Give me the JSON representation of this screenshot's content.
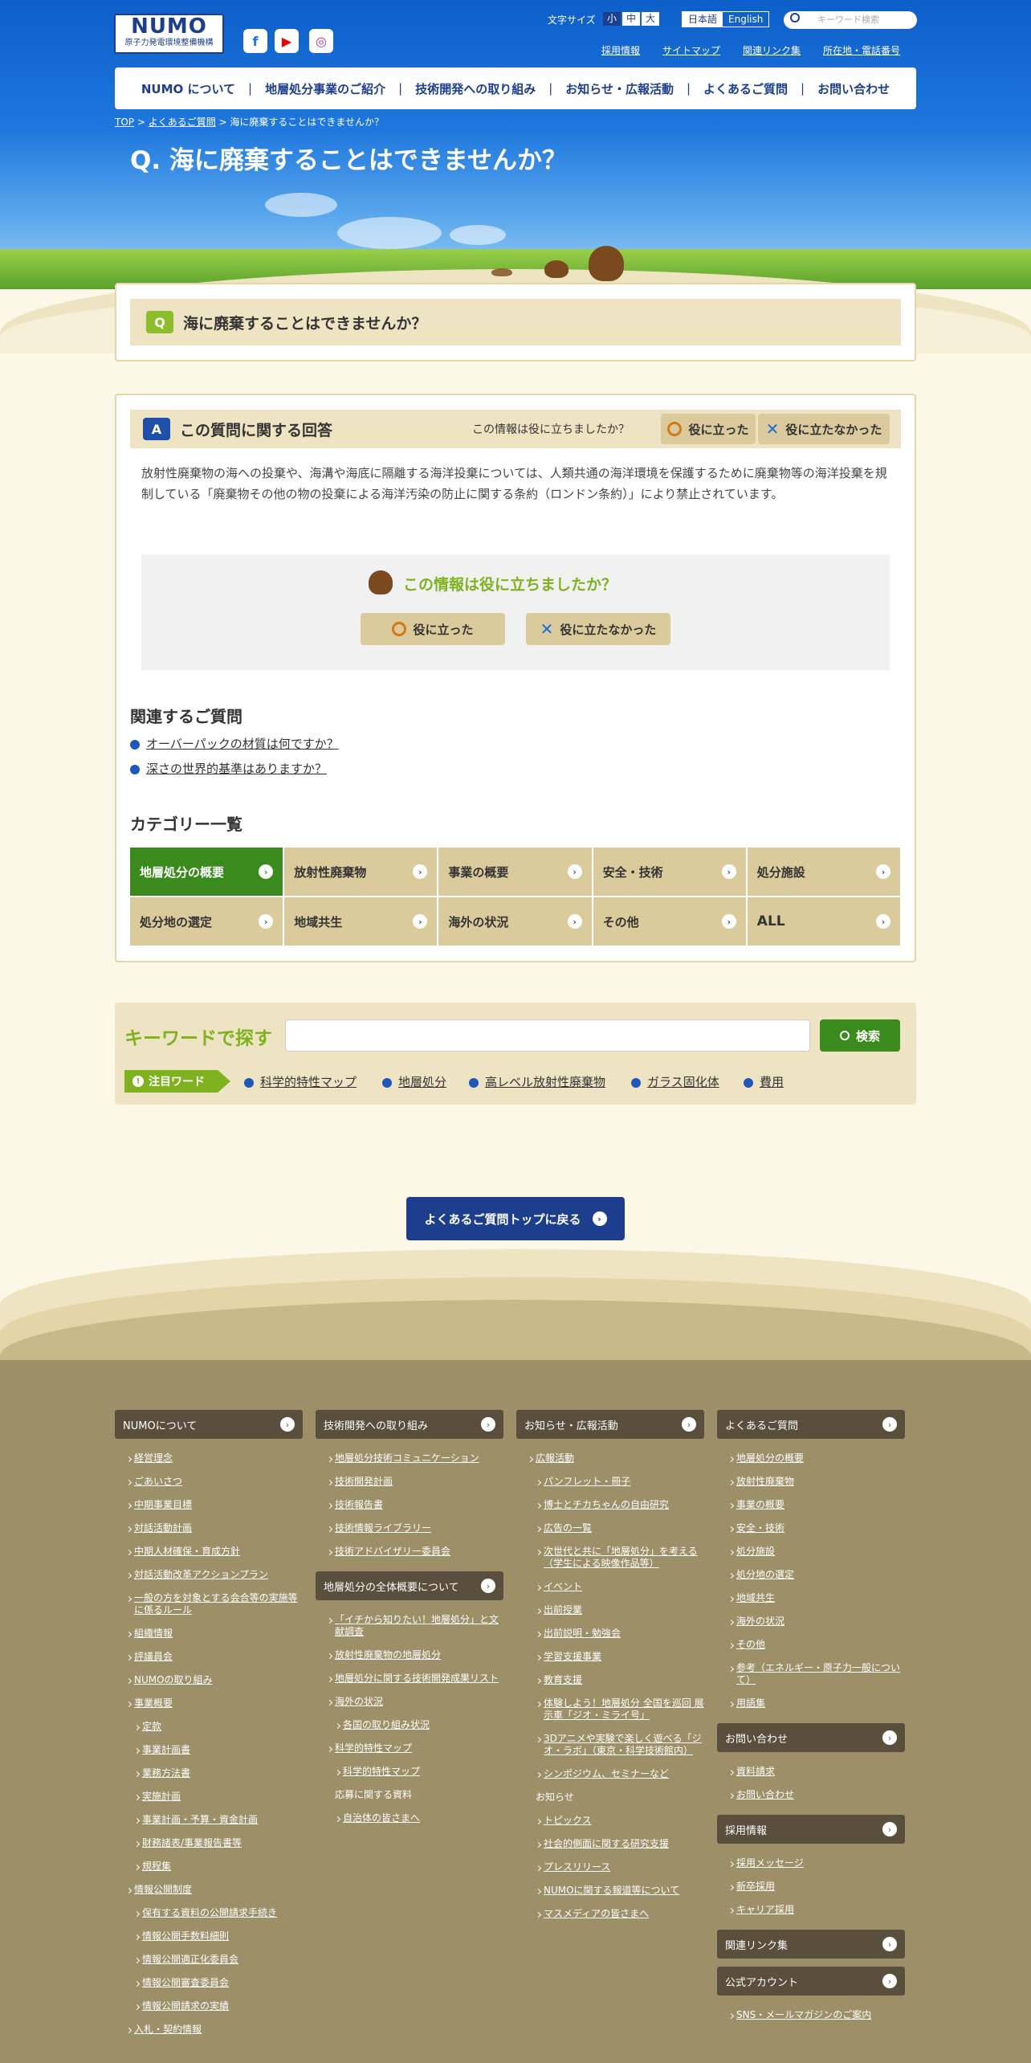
{
  "header": {
    "logo_main": "NUMO",
    "logo_sub": "原子力発電環境整備機構",
    "sns": [
      "f",
      "▶",
      "◎"
    ],
    "font_size_label": "文字サイズ",
    "font_sizes": [
      "小",
      "中",
      "大"
    ],
    "languages": [
      "日本語",
      "English"
    ],
    "search_placeholder": "キーワード検索",
    "top_links": [
      "採用情報",
      "サイトマップ",
      "関連リンク集",
      "所在地・電話番号"
    ]
  },
  "gnav": [
    "NUMO について",
    "地層処分事業のご紹介",
    "技術開発への取り組み",
    "お知らせ・広報活動",
    "よくあるご質問",
    "お問い合わせ"
  ],
  "breadcrumb": [
    "TOP",
    "よくあるご質問",
    "海に廃棄することはできませんか？"
  ],
  "page_title": "Q. 海に廃棄することはできませんか？",
  "question": {
    "badge": "Q",
    "text": "海に廃棄することはできませんか？"
  },
  "answer": {
    "badge": "A",
    "heading": "この質問に関する回答",
    "helpful_question": "この情報は役に立ちましたか？",
    "yes": "役に立った",
    "no": "役に立たなかった",
    "body": "放射性廃棄物の海への投棄や、海溝や海底に隔離する海洋投棄については、人類共通の海洋環境を保護するために廃棄物等の海洋投棄を規制している「廃棄物その他の物の投棄による海洋汚染の防止に関する条約（ロンドン条約）」により禁止されています。"
  },
  "feedback": {
    "title": "この情報は役に立ちましたか？",
    "yes": "役に立った",
    "no": "役に立たなかった"
  },
  "related": {
    "heading": "関連するご質問",
    "items": [
      "オーバーパックの材質は何ですか？",
      "深さの世界的基準はありますか？"
    ]
  },
  "categories": {
    "heading": "カテゴリー一覧",
    "items": [
      "地層処分の概要",
      "放射性廃棄物",
      "事業の概要",
      "安全・技術",
      "処分施設",
      "処分地の選定",
      "地域共生",
      "海外の状況",
      "その他",
      "ALL"
    ]
  },
  "keyword": {
    "heading": "キーワードで探す",
    "button": "検索",
    "featured_label": "注目ワード",
    "words": [
      "科学的特性マップ",
      "地層処分",
      "高レベル放射性廃棄物",
      "ガラス固化体",
      "費用"
    ]
  },
  "back_button": "よくあるご質問トップに戻る",
  "footer": {
    "col1": {
      "head": "NUMOについて",
      "links": [
        {
          "t": "経営理念",
          "s": false
        },
        {
          "t": "ごあいさつ",
          "s": false
        },
        {
          "t": "中期事業目標",
          "s": false
        },
        {
          "t": "対話活動計画",
          "s": false
        },
        {
          "t": "中期人材確保・育成方針",
          "s": false
        },
        {
          "t": "対話活動改革アクションプラン",
          "s": false
        },
        {
          "t": "一般の方を対象とする会合等の実施等に係るルール",
          "s": false
        },
        {
          "t": "組織情報",
          "s": false
        },
        {
          "t": "評議員会",
          "s": false
        },
        {
          "t": "NUMOの取り組み",
          "s": false
        },
        {
          "t": "事業概要",
          "s": false
        },
        {
          "t": "定款",
          "s": true
        },
        {
          "t": "事業計画書",
          "s": true
        },
        {
          "t": "業務方法書",
          "s": true
        },
        {
          "t": "実施計画",
          "s": true
        },
        {
          "t": "事業計画・予算・資金計画",
          "s": true
        },
        {
          "t": "財務諸表/事業報告書等",
          "s": true
        },
        {
          "t": "規程集",
          "s": true
        },
        {
          "t": "情報公開制度",
          "s": false
        },
        {
          "t": "保有する資料の公開請求手続き",
          "s": true
        },
        {
          "t": "情報公開手数料細則",
          "s": true
        },
        {
          "t": "情報公開適正化委員会",
          "s": true
        },
        {
          "t": "情報公開審査委員会",
          "s": true
        },
        {
          "t": "情報公開請求の実績",
          "s": true
        },
        {
          "t": "入札・契約情報",
          "s": false
        }
      ]
    },
    "col2": {
      "head": "技術開発への取り組み",
      "links": [
        "地層処分技術コミュニケーション",
        "技術開発計画",
        "技術報告書",
        "技術情報ライブラリー",
        "技術アドバイザリー委員会"
      ],
      "head2": "地層処分の全体概要について",
      "links2": [
        {
          "t": "「イチから知りたい！地層処分」と文献調査",
          "s": false
        },
        {
          "t": "放射性廃棄物の地層処分",
          "s": false
        },
        {
          "t": "地層処分に関する技術開発成果リスト",
          "s": false
        },
        {
          "t": "海外の状況",
          "s": false
        },
        {
          "t": "各国の取り組み状況",
          "s": true
        },
        {
          "t": "科学的特性マップ",
          "s": false
        },
        {
          "t": "科学的特性マップ",
          "s": true
        },
        {
          "t": "応募に関する資料",
          "plain": true
        },
        {
          "t": "自治体の皆さまへ",
          "s": true
        }
      ]
    },
    "col3": {
      "head": "お知らせ・広報活動",
      "links": [
        {
          "t": "広報活動",
          "s": false
        },
        {
          "t": "パンフレット・冊子",
          "s": true
        },
        {
          "t": "博士とチカちゃんの自由研究",
          "s": true
        },
        {
          "t": "広告の一覧",
          "s": true
        },
        {
          "t": "次世代と共に「地層処分」を考える（学生による映像作品等）",
          "s": true
        },
        {
          "t": "イベント",
          "s": true
        },
        {
          "t": "出前授業",
          "s": true
        },
        {
          "t": "出前説明・勉強会",
          "s": true
        },
        {
          "t": "学習支援事業",
          "s": true
        },
        {
          "t": "教育支援",
          "s": true
        },
        {
          "t": "体験しよう！地層処分 全国を巡回 展示車「ジオ・ミライ号」",
          "s": true
        },
        {
          "t": "3Dアニメや実験で楽しく遊べる「ジオ・ラボ」（東京・科学技術館内）",
          "s": true
        },
        {
          "t": "シンポジウム、セミナーなど",
          "s": true
        },
        {
          "t": "お知らせ",
          "plain": true
        },
        {
          "t": "トピックス",
          "s": true
        },
        {
          "t": "社会的側面に関する研究支援",
          "s": true
        },
        {
          "t": "プレスリリース",
          "s": true
        },
        {
          "t": "NUMOに関する報道等について",
          "s": true
        },
        {
          "t": "マスメディアの皆さまへ",
          "s": true
        }
      ]
    },
    "col4": {
      "head": "よくあるご質問",
      "links": [
        "地層処分の概要",
        "放射性廃棄物",
        "事業の概要",
        "安全・技術",
        "処分施設",
        "処分地の選定",
        "地域共生",
        "海外の状況",
        "その他",
        "参考（エネルギー・原子力一般について）",
        "用語集"
      ],
      "contact_head": "お問い合わせ",
      "contact_links": [
        "資料請求",
        "お問い合わせ"
      ],
      "recruit_head": "採用情報",
      "recruit_links": [
        "採用メッセージ",
        "新卒採用",
        "キャリア採用"
      ],
      "related_head": "関連リンク集",
      "official_head": "公式アカウント",
      "official_links": [
        "SNS・メールマガジンのご案内"
      ]
    }
  },
  "colors": {
    "brand_blue": "#1d3e8c",
    "green": "#3a8a1e",
    "beige": "#dbcb9c",
    "footer": "#9d8f67"
  }
}
